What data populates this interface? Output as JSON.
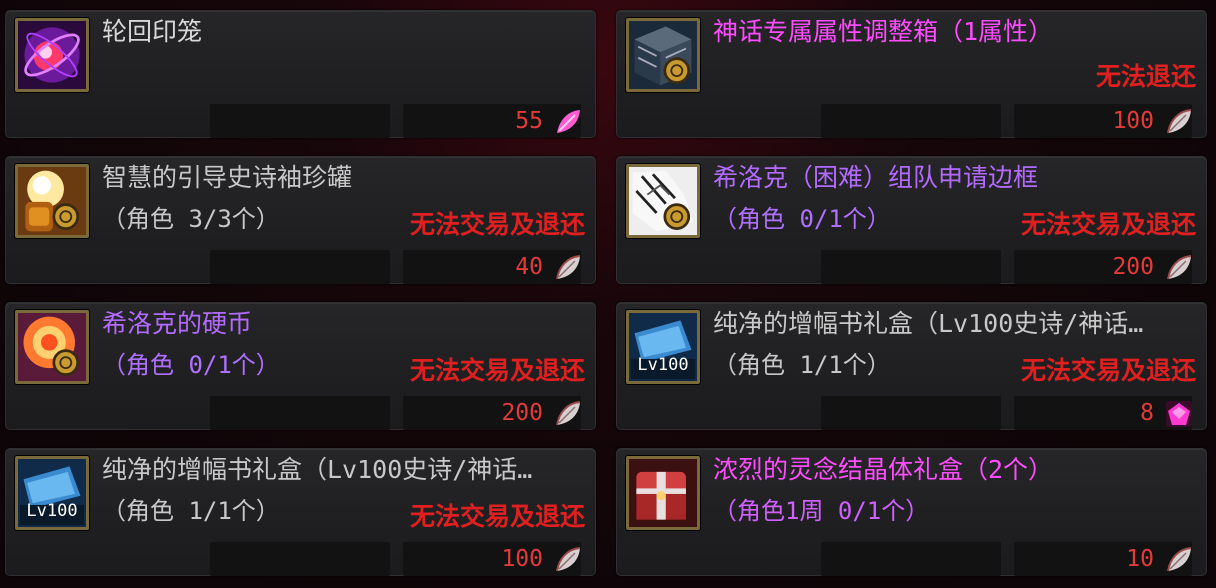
{
  "colors": {
    "title_white": "#d8d8d8",
    "title_purple": "#b36bff",
    "title_magenta": "#ff4cff",
    "sub_gray": "#c8c8c8",
    "sub_purple": "#b070ff",
    "restrict_red": "#e02020",
    "price_red": "#e33a3a"
  },
  "items": [
    {
      "title": "轮回印笼",
      "title_color": "#d8d8d8",
      "subtitle": "",
      "sub_color": "#c8c8c8",
      "restriction": "",
      "price": "55",
      "currency": "pink-feather-icon",
      "icon": "orb-icon"
    },
    {
      "title": "神话专属属性调整箱（1属性）",
      "title_color": "#ff4cff",
      "subtitle": "",
      "sub_color": "#c8c8c8",
      "restriction": "无法退还",
      "price": "100",
      "currency": "gray-feather-icon",
      "icon": "box-icon"
    },
    {
      "title": "智慧的引导史诗袖珍罐",
      "title_color": "#c8c8c8",
      "subtitle": "（角色 3/3个）",
      "sub_color": "#c8c8c8",
      "restriction": "无法交易及退还",
      "price": "40",
      "currency": "gray-feather-icon",
      "icon": "jar-icon"
    },
    {
      "title": "希洛克（困难）组队申请边框",
      "title_color": "#b36bff",
      "subtitle": "（角色 0/1个）",
      "sub_color": "#b070ff",
      "restriction": "无法交易及退还",
      "price": "200",
      "currency": "gray-feather-icon",
      "icon": "frame-icon"
    },
    {
      "title": "希洛克的硬币",
      "title_color": "#b36bff",
      "subtitle": "（角色 0/1个）",
      "sub_color": "#b070ff",
      "restriction": "无法交易及退还",
      "price": "200",
      "currency": "gray-feather-icon",
      "icon": "coin-icon"
    },
    {
      "title": "纯净的增幅书礼盒（Lv100史诗/神话…",
      "title_color": "#c8c8c8",
      "subtitle": "（角色 1/1个）",
      "sub_color": "#c8c8c8",
      "restriction": "无法交易及退还",
      "price": "8",
      "currency": "pink-gem-icon",
      "icon": "gift-box-lv100-icon",
      "icon_label": "Lv100"
    },
    {
      "title": "纯净的增幅书礼盒（Lv100史诗/神话…",
      "title_color": "#c8c8c8",
      "subtitle": "（角色 1/1个）",
      "sub_color": "#c8c8c8",
      "restriction": "无法交易及退还",
      "price": "100",
      "currency": "gray-feather-icon",
      "icon": "gift-box-lv100-icon",
      "icon_label": "Lv100"
    },
    {
      "title": "浓烈的灵念结晶体礼盒（2个）",
      "title_color": "#ff4cff",
      "subtitle": "（角色1周 0/1个）",
      "sub_color": "#d060ff",
      "restriction": "",
      "price": "10",
      "currency": "gray-feather-icon",
      "icon": "red-chest-icon"
    }
  ]
}
